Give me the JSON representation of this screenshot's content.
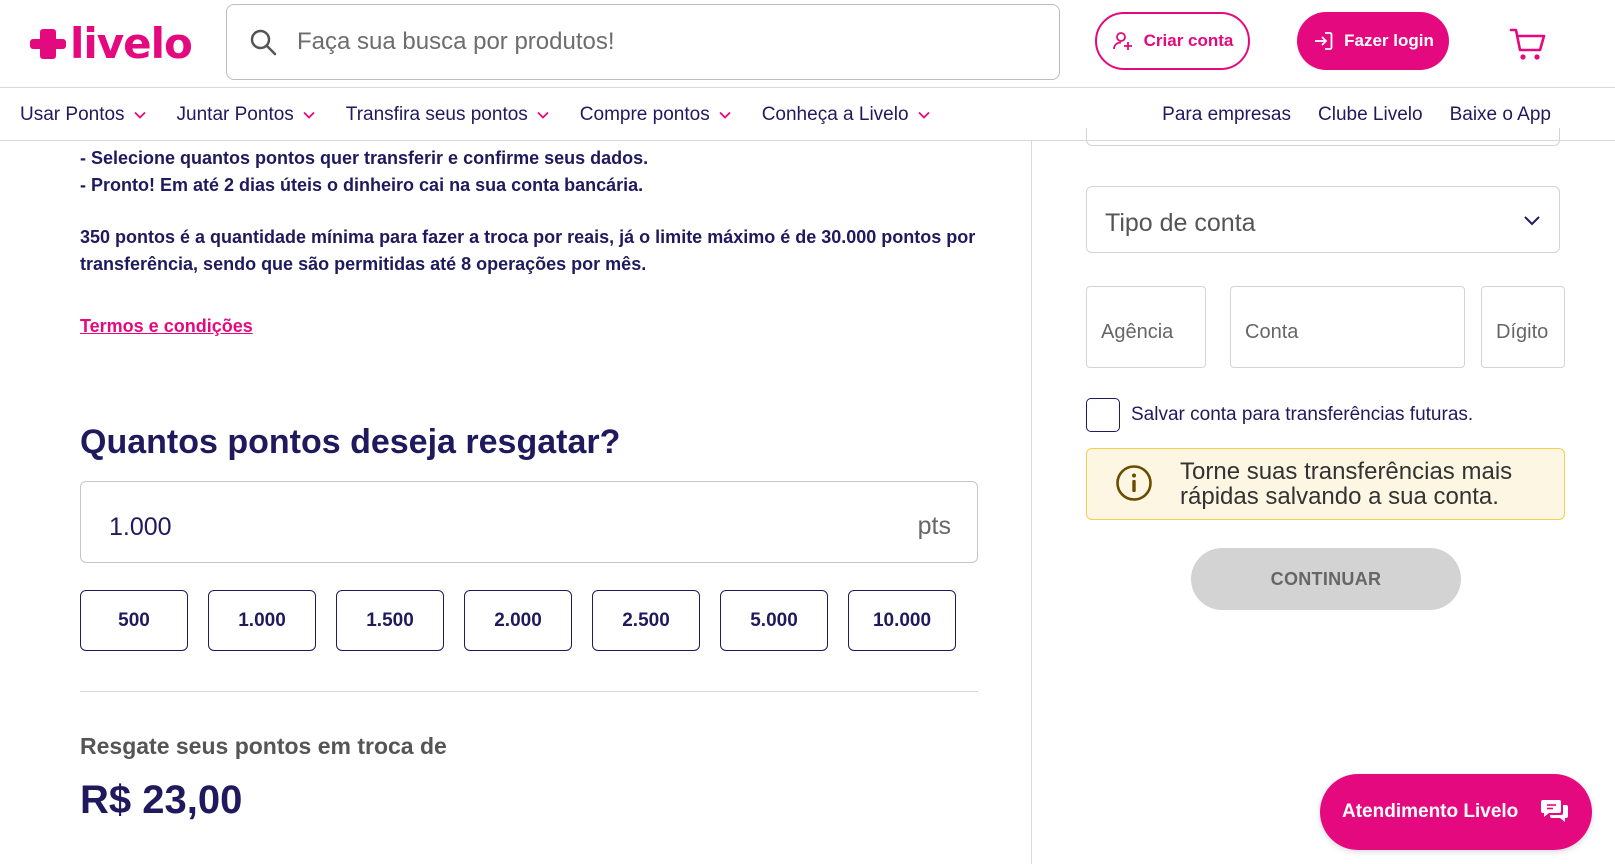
{
  "header": {
    "logo_text": "livelo",
    "search_placeholder": "Faça sua busca por produtos!",
    "create_account_label": "Criar conta",
    "login_label": "Fazer login"
  },
  "nav": {
    "left_items": [
      {
        "label": "Usar Pontos"
      },
      {
        "label": "Juntar Pontos"
      },
      {
        "label": "Transfira seus pontos"
      },
      {
        "label": "Compre pontos"
      },
      {
        "label": "Conheça a Livelo"
      }
    ],
    "right_links": [
      {
        "label": "Para empresas"
      },
      {
        "label": "Clube Livelo"
      },
      {
        "label": "Baixe o App"
      }
    ]
  },
  "main": {
    "step_line_1": "- Selecione quantos pontos quer transferir e confirme seus dados.",
    "step_line_2": "- Pronto! Em até 2 dias úteis o dinheiro cai na sua conta bancária.",
    "limits_text": "350 pontos é a quantidade mínima para fazer a troca por reais, já o limite máximo é de 30.000 pontos por transferência, sendo que são permitidas até 8 operações por mês.",
    "terms_link": "Termos e condições",
    "question": "Quantos pontos deseja resgatar?",
    "points_value": "1.000",
    "points_unit": "pts",
    "chips": [
      "500",
      "1.000",
      "1.500",
      "2.000",
      "2.500",
      "5.000",
      "10.000"
    ],
    "redeem_label": "Resgate seus pontos em troca de",
    "redeem_value": "R$ 23,00"
  },
  "form": {
    "account_type_label": "Tipo de conta",
    "agencia_placeholder": "Agência",
    "conta_placeholder": "Conta",
    "digito_placeholder": "Dígito",
    "save_account_label": "Salvar conta para transferências futuras.",
    "info_text": "Torne suas transferências mais rápidas salvando a sua conta.",
    "continue_label": "CONTINUAR"
  },
  "chat": {
    "label": "Atendimento Livelo"
  },
  "colors": {
    "brand_pink": "#e5097f",
    "navy_text": "#1f1a5e",
    "info_bg": "#fdf6e3",
    "info_border": "#f2cf4d",
    "disabled_button": "#d3d3d3"
  }
}
